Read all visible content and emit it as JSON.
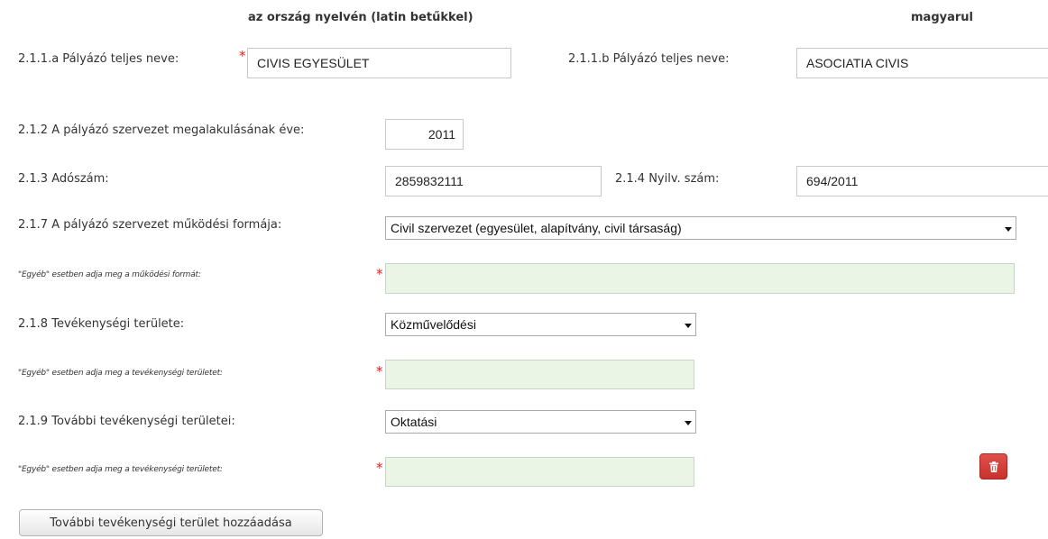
{
  "headers": {
    "native_language": "az ország nyelvén (latin betűkkel)",
    "hungarian": "magyarul"
  },
  "fields": {
    "name_native": {
      "label": "2.1.1.a Pályázó teljes neve:",
      "value": "CIVIS EGYESÜLET"
    },
    "name_hungarian": {
      "label": "2.1.1.b Pályázó teljes neve:",
      "value": "ASOCIATIA CIVIS"
    },
    "founding_year": {
      "label": "2.1.2 A pályázó szervezet megalakulásának éve:",
      "value": "2011"
    },
    "tax_number": {
      "label": "2.1.3 Adószám:",
      "value": "2859832111"
    },
    "registry_number": {
      "label": "2.1.4 Nyilv. szám:",
      "value": "694/2011"
    },
    "operating_form": {
      "label": "2.1.7 A pályázó szervezet működési formája:",
      "selected": "Civil szervezet (egyesület, alapítvány, civil társaság)"
    },
    "operating_form_other": {
      "label": "\"Egyéb\" esetben adja meg a működési formát:",
      "value": ""
    },
    "activity_area": {
      "label": "2.1.8 Tevékenységi területe:",
      "selected": "Közművelődési"
    },
    "activity_area_other": {
      "label": "\"Egyéb\" esetben adja meg a tevékenységi területet:",
      "value": ""
    },
    "additional_activity": {
      "label": "2.1.9 További tevékenységi területei:",
      "selected": "Oktatási"
    },
    "additional_activity_other": {
      "label": "\"Egyéb\" esetben adja meg a tevékenységi területet:",
      "value": ""
    }
  },
  "required_marker": "*",
  "buttons": {
    "add_activity": "További tevékenységi terület hozzáadása"
  },
  "icons": {
    "delete": "trash-icon"
  },
  "colors": {
    "required": "#e02020",
    "other_field_bg": "#ebf5e6",
    "delete_button": "#d9534f"
  }
}
